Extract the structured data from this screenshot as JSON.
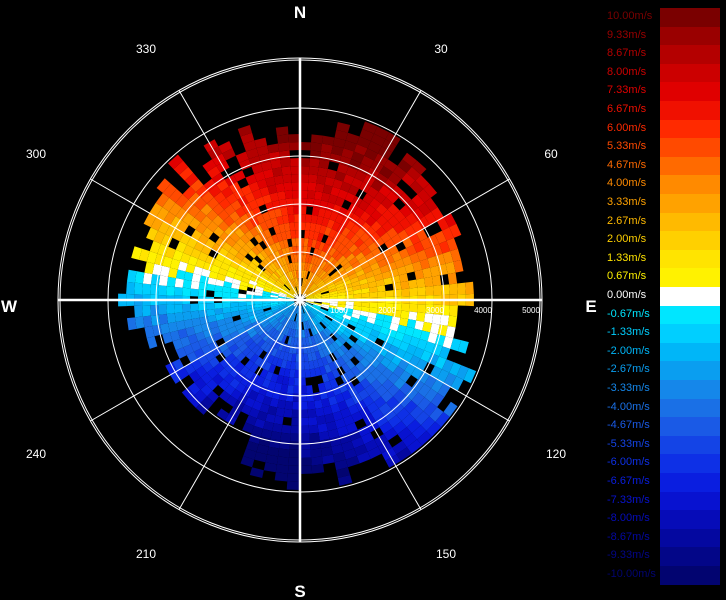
{
  "compass": {
    "north": "N",
    "south": "S",
    "east": "E",
    "west": "W"
  },
  "azimuth_labels": [
    "30",
    "60",
    "120",
    "150",
    "210",
    "240",
    "300",
    "330"
  ],
  "range_labels": [
    "1000",
    "2000",
    "3000",
    "4000",
    "5000"
  ],
  "legend": [
    {
      "label": "10.00m/s",
      "color": "#7a0000"
    },
    {
      "label": "9.33m/s",
      "color": "#9a0000"
    },
    {
      "label": "8.67m/s",
      "color": "#b40000"
    },
    {
      "label": "8.00m/s",
      "color": "#cc0000"
    },
    {
      "label": "7.33m/s",
      "color": "#e00000"
    },
    {
      "label": "6.67m/s",
      "color": "#f01000"
    },
    {
      "label": "6.00m/s",
      "color": "#ff2a00"
    },
    {
      "label": "5.33m/s",
      "color": "#ff4a00"
    },
    {
      "label": "4.67m/s",
      "color": "#ff6a00"
    },
    {
      "label": "4.00m/s",
      "color": "#ff8a00"
    },
    {
      "label": "3.33m/s",
      "color": "#ffa200"
    },
    {
      "label": "2.67m/s",
      "color": "#ffba00"
    },
    {
      "label": "2.00m/s",
      "color": "#ffd000"
    },
    {
      "label": "1.33m/s",
      "color": "#ffe400"
    },
    {
      "label": "0.67m/s",
      "color": "#fff200"
    },
    {
      "label": "0.00m/s",
      "color": "#ffffff"
    },
    {
      "label": "-0.67m/s",
      "color": "#00e6ff"
    },
    {
      "label": "-1.33m/s",
      "color": "#00cfff"
    },
    {
      "label": "-2.00m/s",
      "color": "#00b6f8"
    },
    {
      "label": "-2.67m/s",
      "color": "#0a9ef0"
    },
    {
      "label": "-3.33m/s",
      "color": "#1587ea"
    },
    {
      "label": "-4.00m/s",
      "color": "#1a70e6"
    },
    {
      "label": "-4.67m/s",
      "color": "#1a5ae6"
    },
    {
      "label": "-5.33m/s",
      "color": "#1444e6"
    },
    {
      "label": "-6.00m/s",
      "color": "#0e30e6"
    },
    {
      "label": "-6.67m/s",
      "color": "#0a1ee0"
    },
    {
      "label": "-7.33m/s",
      "color": "#0812d0"
    },
    {
      "label": "-8.00m/s",
      "color": "#060cb8"
    },
    {
      "label": "-8.67m/s",
      "color": "#0408a0"
    },
    {
      "label": "-9.33m/s",
      "color": "#030688"
    },
    {
      "label": "-10.00m/s",
      "color": "#020470"
    }
  ]
}
